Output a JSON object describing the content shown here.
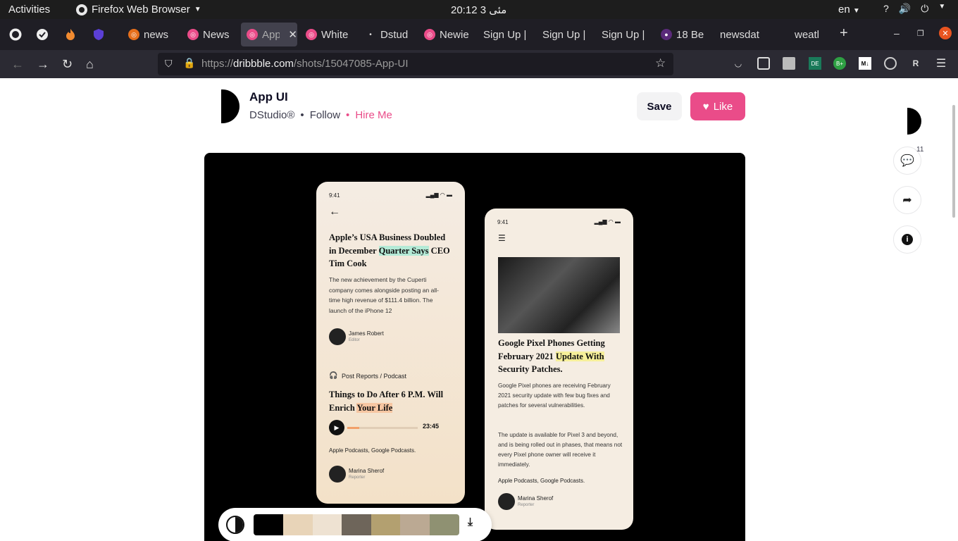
{
  "system_bar": {
    "activities": "Activities",
    "app_name": "Firefox Web Browser",
    "clock": "20:12  مئى 3",
    "lang": "en"
  },
  "tabs": [
    {
      "label": "news",
      "fav_color": "#e66f1b"
    },
    {
      "label": "News",
      "fav_color": "#ea4c89"
    },
    {
      "label": "App UI",
      "fav_color": "#ea4c89",
      "active": true
    },
    {
      "label": "White",
      "fav_color": "#ea4c89"
    },
    {
      "label": "Dstud",
      "fav_color": "#888888"
    },
    {
      "label": "Newie",
      "fav_color": "#ea4c89"
    },
    {
      "label": "Sign Up |",
      "fav_color": ""
    },
    {
      "label": "Sign Up |",
      "fav_color": ""
    },
    {
      "label": "Sign Up |",
      "fav_color": ""
    },
    {
      "label": "18 Be",
      "fav_color": "#5a2a7a"
    },
    {
      "label": "newsdat",
      "fav_color": ""
    },
    {
      "label": "weatl",
      "fav_color": ""
    }
  ],
  "url": {
    "prefix": "https://",
    "domain": "dribbble.com",
    "path": "/shots/15047085-App-UI"
  },
  "shot": {
    "title": "App UI",
    "author": "DStudio®",
    "follow": "Follow",
    "hire": "Hire Me",
    "save": "Save",
    "like": "Like",
    "comments_count": "11"
  },
  "phone1": {
    "time": "9:41",
    "headline_a": "Apple’s USA Business Doubled in December ",
    "headline_hl": "Quarter Says",
    "headline_b": " CEO Tim Cook",
    "body": "The new achievement by the Cuperti company comes alongside posting an all-time high revenue of $111.4 billion. The launch of the iPhone 12",
    "author_name": "James Robert",
    "author_role": "Editor",
    "section": "Post Reports / Podcast",
    "podcast_a": "Things to Do After 6 P.M. Will Enrich ",
    "podcast_hl": "Your Life",
    "duration": "23:45",
    "progress": 0.17,
    "sources": "Apple Podcasts, Google Podcasts.",
    "author2_name": "Marina Sherof",
    "author2_role": "Reporter"
  },
  "phone2": {
    "time": "9:41",
    "headline_a": "Google Pixel Phones Getting February 2021 ",
    "headline_hl": "Update With",
    "headline_b": " Security Patches.",
    "body1": "Google Pixel phones are receiving February 2021 security update with few bug fixes and patches for several vulnerabilities.",
    "body2": "The update is available for Pixel 3 and beyond, and is being rolled out in phases, that means not every Pixel phone owner will receive it immediately.",
    "sources": "Apple Podcasts, Google Podcasts.",
    "author_name": "Marina Sherof",
    "author_role": "Reporter"
  },
  "palette": [
    "#000000",
    "#e8d4b8",
    "#eee2d2",
    "#6e655a",
    "#b3a070",
    "#bba993",
    "#8f9172"
  ]
}
